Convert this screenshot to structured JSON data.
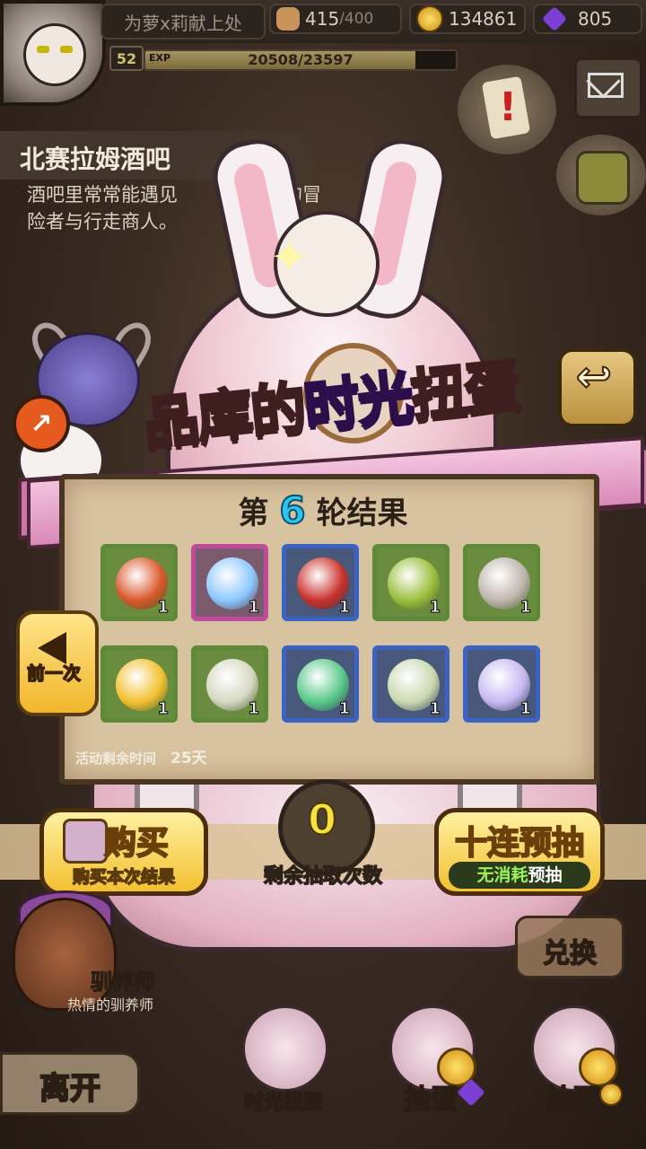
{
  "player": {
    "name": "为萝x莉献上处",
    "level": "52",
    "exp_label": "EXP",
    "exp_text": "20508/23597",
    "exp_progress": 0.869
  },
  "resources": {
    "stamina_value": "415",
    "stamina_max": "/400",
    "gold": "134861",
    "gems": "805"
  },
  "location": {
    "title": "北赛拉姆酒吧",
    "description_line1": "酒吧里常常能遇见",
    "description_line1b": "的冒",
    "description_line2": "险者与行走商人。"
  },
  "banner": {
    "part1": "品库的",
    "highlight": "时光",
    "part2": "扭蛋"
  },
  "result": {
    "prefix": "第",
    "round": "6",
    "suffix": "轮结果",
    "items": [
      {
        "name": "fire-ore-icon",
        "qty": "1",
        "frame": "#5e8a37",
        "bg": "#6a8c3e",
        "art": "#d9582a"
      },
      {
        "name": "blue-crystal-icon",
        "qty": "1",
        "frame": "#c04a9c",
        "bg": "#7a5b6e",
        "art": "#8cc8ff"
      },
      {
        "name": "red-helmet-icon",
        "qty": "1",
        "frame": "#3b63c4",
        "bg": "#48587a",
        "art": "#c8312a"
      },
      {
        "name": "green-sprout-icon",
        "qty": "1",
        "frame": "#5e8a37",
        "bg": "#6a8c3e",
        "art": "#9bbf3c"
      },
      {
        "name": "gray-fur-icon",
        "qty": "1",
        "frame": "#5e8a37",
        "bg": "#6a8c3e",
        "art": "#bfb5ad"
      },
      {
        "name": "gold-slime-icon",
        "qty": "1",
        "frame": "#5e8a37",
        "bg": "#6a8c3e",
        "art": "#f3c130"
      },
      {
        "name": "speckled-egg-icon",
        "qty": "1",
        "frame": "#5e8a37",
        "bg": "#6a8c3e",
        "art": "#d6d9c2"
      },
      {
        "name": "green-slime-icon",
        "qty": "1",
        "frame": "#3b63c4",
        "bg": "#48587a",
        "art": "#58c98a"
      },
      {
        "name": "leaf-seed-icon",
        "qty": "1",
        "frame": "#3b63c4",
        "bg": "#48587a",
        "art": "#cbd9b0"
      },
      {
        "name": "purple-jelly-icon",
        "qty": "1",
        "frame": "#3b63c4",
        "bg": "#48587a",
        "art": "#c7b9f2"
      }
    ],
    "timer_label": "活动剩余时间",
    "timer_value": "25天"
  },
  "prev_button": {
    "label": "前一次"
  },
  "buy_button": {
    "title": "购买",
    "subtitle": "购买本次结果"
  },
  "draws": {
    "count": "0",
    "label": "剩余抽取次数"
  },
  "ten_button": {
    "title": "十连预抽",
    "sub_highlight": "无消耗",
    "sub_rest": "预抽"
  },
  "exchange_button": {
    "label": "兑换"
  },
  "npc": {
    "name": "驯养师",
    "description": "热情的驯养师"
  },
  "leave_button": {
    "label": "离开"
  },
  "nav": [
    {
      "label": "时光扭蛋"
    },
    {
      "label": "抽蛋"
    },
    {
      "label": "抽蛋"
    }
  ],
  "colors": {
    "gold_accent": "#f3c030",
    "round_number": "#2ec4f0",
    "count_number": "#f7e23c",
    "gem_purple": "#7b3fd6"
  }
}
